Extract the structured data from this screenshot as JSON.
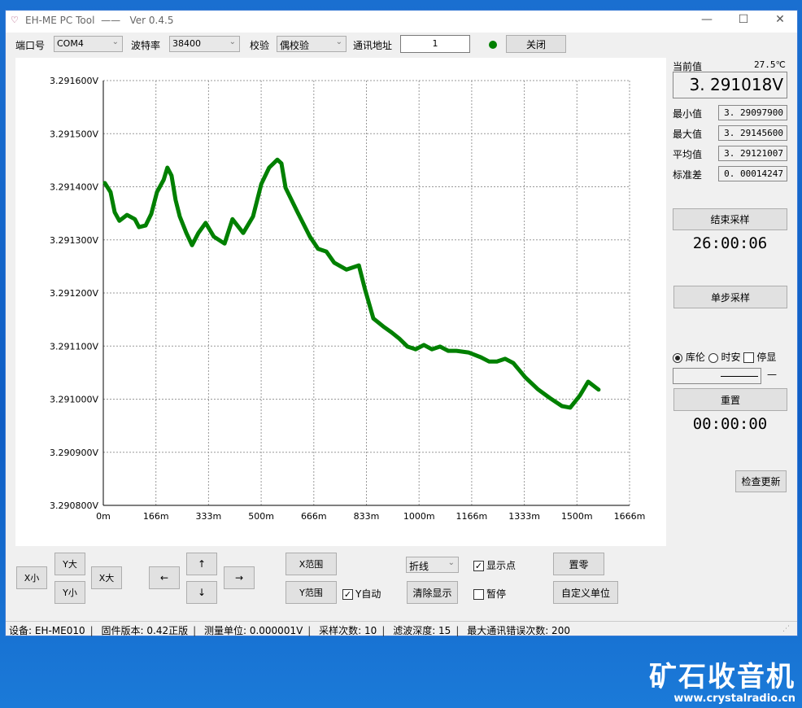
{
  "window": {
    "title": "EH-ME PC Tool",
    "version": "Ver 0.4.5",
    "minimize": "—",
    "maximize": "☐",
    "close": "✕"
  },
  "toolbar": {
    "port_label": "端口号",
    "port_value": "COM4",
    "baud_label": "波特率",
    "baud_value": "38400",
    "parity_label": "校验",
    "parity_value": "偶校验",
    "addr_label": "通讯地址",
    "addr_value": "1",
    "status_color": "#008000",
    "close_btn": "关闭"
  },
  "right": {
    "current_label": "当前值",
    "temperature": "27.5℃",
    "current_value": "3. 291018V",
    "min_label": "最小值",
    "min_value": "3. 29097900",
    "max_label": "最大值",
    "max_value": "3. 29145600",
    "avg_label": "平均值",
    "avg_value": "3. 29121007",
    "std_label": "标准差",
    "std_value": "0. 00014247",
    "stop_btn": "结束采样",
    "elapsed": "26:00:06",
    "single_btn": "单步采样",
    "radio1": "库伦",
    "radio2": "时安",
    "check_hold": "停显",
    "dash": "—",
    "reset_btn": "重置",
    "timer2": "00:00:00",
    "update_btn": "检查更新"
  },
  "controls": {
    "x_small": "X小",
    "y_big": "Y大",
    "y_small": "Y小",
    "x_big": "X大",
    "left": "←",
    "up": "↑",
    "down": "↓",
    "right": "→",
    "x_range": "X范围",
    "y_range": "Y范围",
    "y_auto": "Y自动",
    "chart_type": "折线",
    "clear": "清除显示",
    "show_points": "显示点",
    "pause": "暂停",
    "zero": "置零",
    "custom_unit": "自定义单位"
  },
  "status": {
    "device": "设备:  EH-ME010",
    "firmware": "固件版本:  0.42正版",
    "unit": "测量单位:   0.000001V",
    "samples": "采样次数:   10",
    "filter": "滤波深度:  15",
    "errors": "最大通讯错误次数:  200"
  },
  "watermark": {
    "brand": "矿石收音机",
    "url": "www.crystalradio.cn"
  },
  "chart_data": {
    "type": "line",
    "color": "#008000",
    "xlabel": "",
    "ylabel": "",
    "xlim": [
      0,
      1666
    ],
    "ylim": [
      3.2908,
      3.2916
    ],
    "x_ticks": [
      "0m",
      "166m",
      "333m",
      "500m",
      "666m",
      "833m",
      "1000m",
      "1166m",
      "1333m",
      "1500m",
      "1666m"
    ],
    "y_ticks": [
      "3.290800V",
      "3.290900V",
      "3.291000V",
      "3.291100V",
      "3.291200V",
      "3.291300V",
      "3.291400V",
      "3.291500V",
      "3.291600V"
    ],
    "grid": true,
    "x": [
      5,
      23,
      36,
      51,
      75,
      100,
      113,
      134,
      152,
      170,
      191,
      203,
      216,
      229,
      242,
      263,
      281,
      301,
      324,
      350,
      384,
      409,
      443,
      474,
      500,
      525,
      551,
      564,
      577,
      615,
      654,
      680,
      706,
      731,
      770,
      809,
      829,
      855,
      886,
      912,
      937,
      963,
      989,
      1015,
      1040,
      1066,
      1092,
      1118,
      1156,
      1195,
      1221,
      1246,
      1272,
      1298,
      1336,
      1375,
      1414,
      1452,
      1478,
      1509,
      1535,
      1568
    ],
    "y": [
      3.291407,
      3.29139,
      3.291352,
      3.291336,
      3.291347,
      3.291339,
      3.291324,
      3.291327,
      3.291349,
      3.29139,
      3.291413,
      3.291436,
      3.291421,
      3.291375,
      3.291344,
      3.291313,
      3.29129,
      3.291313,
      3.291332,
      3.291306,
      3.291293,
      3.291339,
      3.291313,
      3.291344,
      3.291405,
      3.291436,
      3.291451,
      3.291444,
      3.291398,
      3.291352,
      3.291306,
      3.291283,
      3.291278,
      3.291257,
      3.291244,
      3.291252,
      3.291206,
      3.291152,
      3.291137,
      3.291126,
      3.291114,
      3.291099,
      3.291094,
      3.291102,
      3.291094,
      3.291099,
      3.291091,
      3.291091,
      3.291088,
      3.291079,
      3.291071,
      3.291071,
      3.291076,
      3.291068,
      3.291041,
      3.291019,
      3.291002,
      3.290987,
      3.290984,
      3.291007,
      3.291033,
      3.291018
    ]
  }
}
